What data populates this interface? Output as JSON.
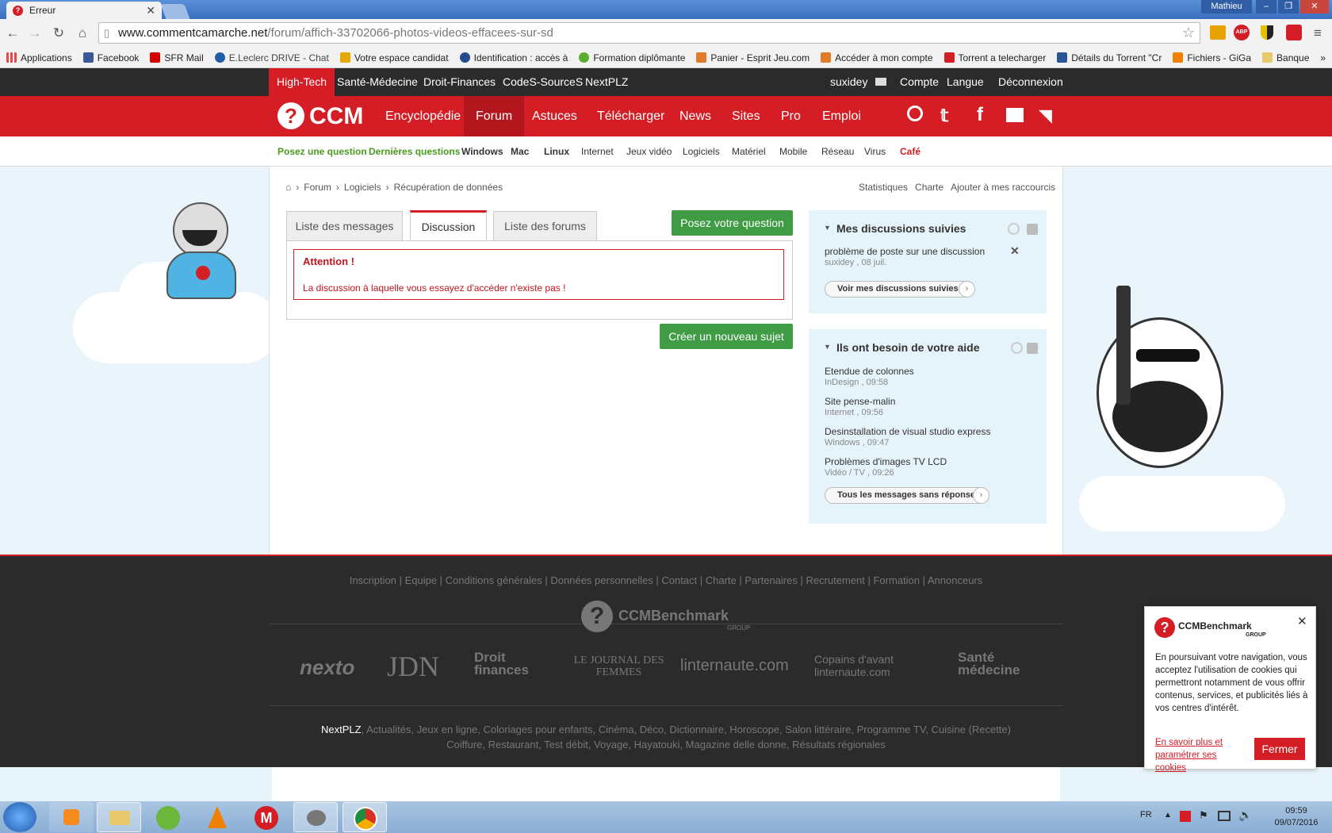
{
  "browser": {
    "tab_title": "Erreur",
    "user": "Mathieu",
    "url_domain": "www.commentcamarche.net",
    "url_path": "/forum/affich-33702066-photos-videos-effacees-sur-sd",
    "bookmarks": [
      {
        "label": "Applications",
        "color": "#e44"
      },
      {
        "label": "Facebook",
        "color": "#3b5998"
      },
      {
        "label": "SFR Mail",
        "color": "#d40000"
      },
      {
        "label": "E.Leclerc DRIVE - Chat",
        "color": "#1f5fa8"
      },
      {
        "label": "Votre espace candidat",
        "color": "#e7a800"
      },
      {
        "label": "Identification : accès à",
        "color": "#264b8c"
      },
      {
        "label": "Formation diplômante",
        "color": "#5aad2e"
      },
      {
        "label": "Panier - Esprit Jeu.com",
        "color": "#e07b2a"
      },
      {
        "label": "Accéder à mon compte",
        "color": "#e07b2a"
      },
      {
        "label": "Torrent a telecharger",
        "color": "#d41d24"
      },
      {
        "label": "Détails du Torrent \"Cr",
        "color": "#2a5599"
      },
      {
        "label": "Fichiers - GiGa",
        "color": "#f08000"
      },
      {
        "label": "Banque",
        "color": "#e8c96b"
      }
    ]
  },
  "site": {
    "topnav_left": [
      "High-Tech",
      "Santé-Médecine",
      "Droit-Finances",
      "CodeS-SourceS",
      "NextPLZ"
    ],
    "topnav_right": [
      "suxidey",
      "Compte",
      "Langue",
      "Déconnexion"
    ],
    "logo": "CCM",
    "mainnav": [
      "Encyclopédie",
      "Forum",
      "Astuces",
      "Télécharger",
      "News",
      "Sites",
      "Pro",
      "Emploi"
    ],
    "subnav": [
      "Posez une question",
      "Dernières questions",
      "Windows",
      "Mac",
      "Linux",
      "Internet",
      "Jeux vidéo",
      "Logiciels",
      "Matériel",
      "Mobile",
      "Réseau",
      "Virus",
      "Café"
    ]
  },
  "breadcrumb": [
    "Forum",
    "Logiciels",
    "Récupération de données"
  ],
  "crumb_links": [
    "Statistiques",
    "Charte",
    "Ajouter à mes raccourcis"
  ],
  "tabs": [
    "Liste des messages",
    "Discussion",
    "Liste des forums"
  ],
  "ask_button": "Posez votre question",
  "alert": {
    "title": "Attention !",
    "message": "La discussion à laquelle vous essayez d'accéder n'existe pas !"
  },
  "new_topic_button": "Créer un nouveau sujet",
  "followed": {
    "title": "Mes discussions suivies",
    "items": [
      {
        "title": "problème de poste sur une discussion",
        "meta": "suxidey , 08 juil."
      }
    ],
    "button": "Voir mes discussions suivies"
  },
  "help": {
    "title": "Ils ont besoin de votre aide",
    "items": [
      {
        "title": "Etendue de colonnes",
        "meta": "InDesign , 09:58"
      },
      {
        "title": "Site pense-malin",
        "meta": "Internet , 09:56"
      },
      {
        "title": "Desinstallation de visual studio express",
        "meta": "Windows , 09:47"
      },
      {
        "title": "Problèmes d'images TV LCD",
        "meta": "Vidéo / TV , 09:26"
      }
    ],
    "button": "Tous les messages sans réponse"
  },
  "footer": {
    "links": "Inscription | Equipe | Conditions générales | Données personnelles | Contact | Charte | Partenaires | Recrutement | Formation | Annonceurs",
    "brand": "CCMBenchmark",
    "brand_sub": "GROUP",
    "partners": [
      "nexto",
      "JDN",
      "Droit finances",
      "LE JOURNAL DES FEMMES",
      "linternaute.com",
      "Copains d'avant linternaute.com",
      "Santé médecine"
    ],
    "bottom_strong": "NextPLZ",
    "bottom_line1": ", Actualités, Jeux en ligne, Coloriages pour enfants, Cinéma, Déco, Dictionnaire, Horoscope, Salon littéraire, Programme TV, Cuisine (Recette)",
    "bottom_line2": "Coiffure, Restaurant, Test débit, Voyage, Hayatouki, Magazine delle donne, Résultats régionales"
  },
  "cookie": {
    "brand": "CCMBenchmark",
    "brand_sub": "GROUP",
    "text": "En poursuivant votre navigation, vous acceptez l'utilisation de cookies qui permettront notamment de vous offrir contenus, services, et publicités liés à vos centres d'intérêt.",
    "link": "En savoir plus et paramétrer ses cookies",
    "close": "Fermer"
  },
  "taskbar": {
    "lang": "FR",
    "time": "09:59",
    "date": "09/07/2016"
  },
  "colors": {
    "accent": "#d41d24",
    "green": "#3f9c44",
    "dark": "#2b2b2b"
  }
}
